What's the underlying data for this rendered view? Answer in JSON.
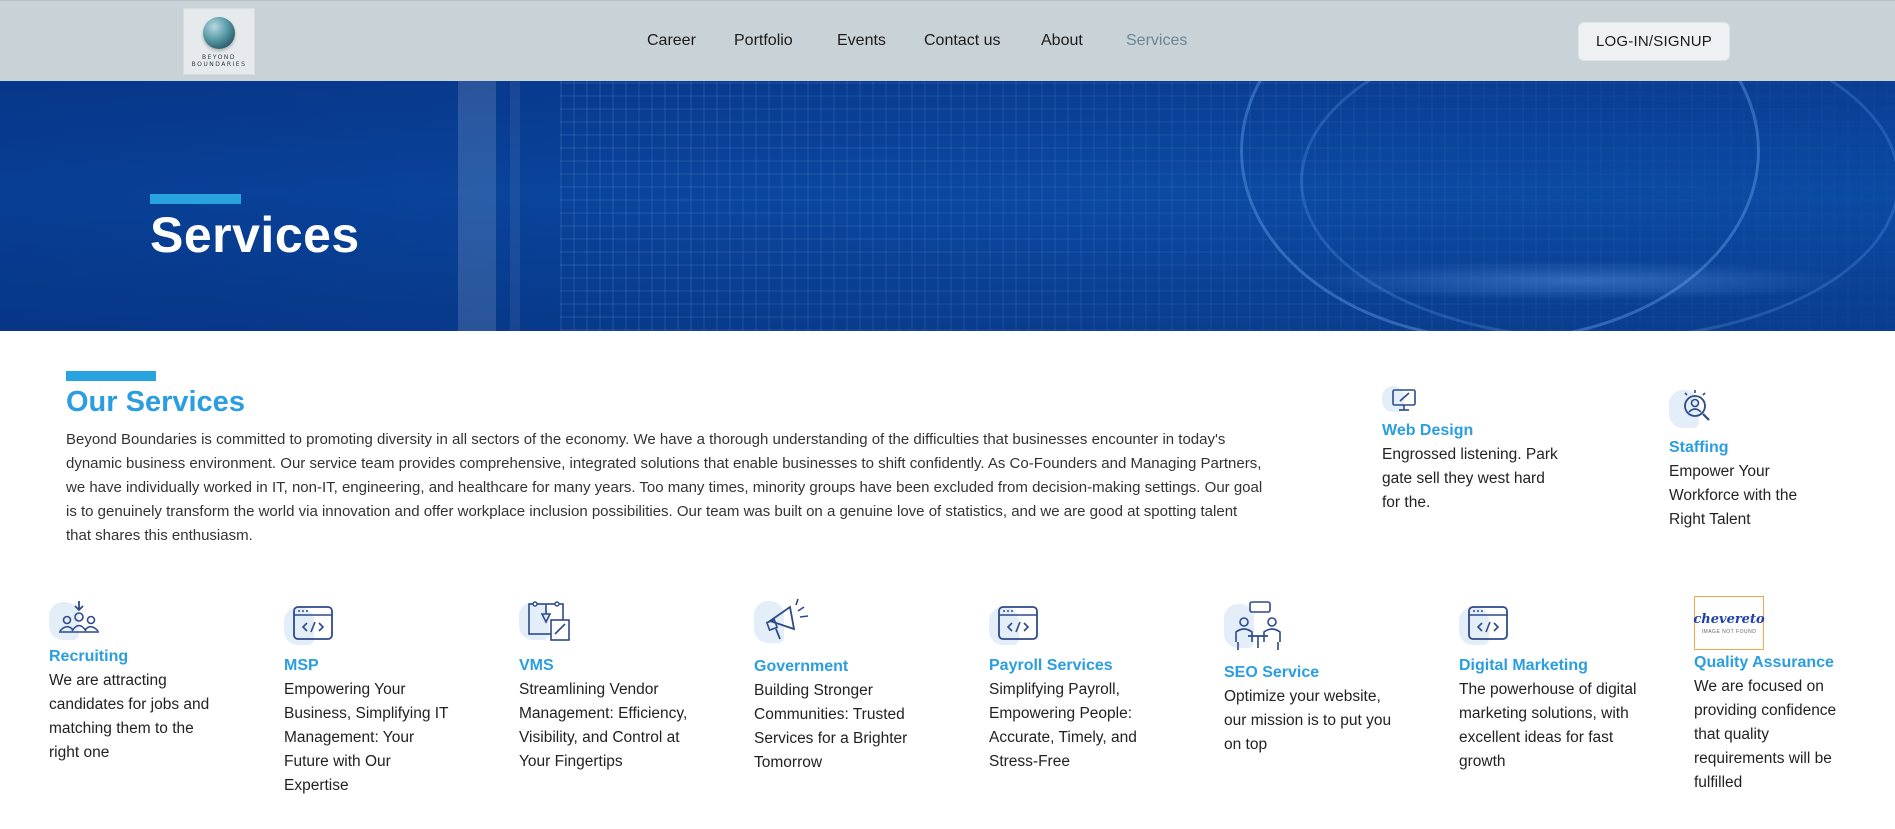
{
  "brand": {
    "logo_text": "BEYOND BOUNDARIES"
  },
  "nav": {
    "items": [
      {
        "label": "Career"
      },
      {
        "label": "Portfolio"
      },
      {
        "label": "Events"
      },
      {
        "label": "Contact us"
      },
      {
        "label": "About"
      },
      {
        "label": "Services",
        "active": true
      }
    ],
    "login_label": "LOG-IN/SIGNUP"
  },
  "hero": {
    "title": "Services"
  },
  "our_services": {
    "title": "Our Services",
    "description": "Beyond Boundaries is committed to promoting diversity in all sectors of the economy. We have a thorough understanding of the difficulties that businesses encounter in today's dynamic business environment. Our service team provides comprehensive, integrated solutions that enable businesses to shift confidently. As Co-Founders and Managing Partners, we have individually worked in IT, non-IT, engineering, and healthcare for many years. Too many times, minority groups have been excluded from decision-making settings. Our goal is to genuinely transform the world via innovation and offer workplace inclusion possibilities. Our team was built on a genuine love of statistics, and we are good at spotting talent that shares this enthusiasm."
  },
  "services": [
    {
      "title": "Web Design",
      "desc": "Engrossed listening. Park gate sell they west hard for the.",
      "icon": "monitor-design-icon"
    },
    {
      "title": "Staffing",
      "desc": "Empower Your Workforce with the Right Talent",
      "icon": "staffing-search-icon"
    },
    {
      "title": "Recruiting",
      "desc": "We are attracting candidates for jobs and matching them to the right one",
      "icon": "recruiting-team-icon"
    },
    {
      "title": "MSP",
      "desc": "Empowering Your Business, Simplifying IT Management: Your Future with Our Expertise",
      "icon": "code-window-icon"
    },
    {
      "title": "VMS",
      "desc": "Streamlining Vendor Management: Efficiency, Visibility, and Control at Your Fingertips",
      "icon": "design-tools-icon"
    },
    {
      "title": "Government",
      "desc": "Building Stronger Communities: Trusted Services for a Brighter Tomorrow",
      "icon": "megaphone-icon"
    },
    {
      "title": "Payroll Services",
      "desc": "Simplifying Payroll, Empowering People: Accurate, Timely, and Stress-Free",
      "icon": "code-window-icon"
    },
    {
      "title": "SEO Service",
      "desc": "Optimize your website, our mission is to put you on top",
      "icon": "meeting-people-icon"
    },
    {
      "title": "Digital Marketing",
      "desc": "The powerhouse of digital marketing solutions, with excellent ideas for fast growth",
      "icon": "code-window-icon"
    },
    {
      "title": "Quality Assurance",
      "desc": "We are focused on providing confidence that quality requirements will be fulfilled",
      "icon": "image-not-found-placeholder"
    }
  ],
  "placeholder_image": {
    "brand": "chevereto",
    "sub": "IMAGE NOT FOUND"
  },
  "colors": {
    "accent": "#2a9ee0",
    "nav_bg": "#c9d2d6",
    "hero_bg": "#0b4aa3"
  }
}
